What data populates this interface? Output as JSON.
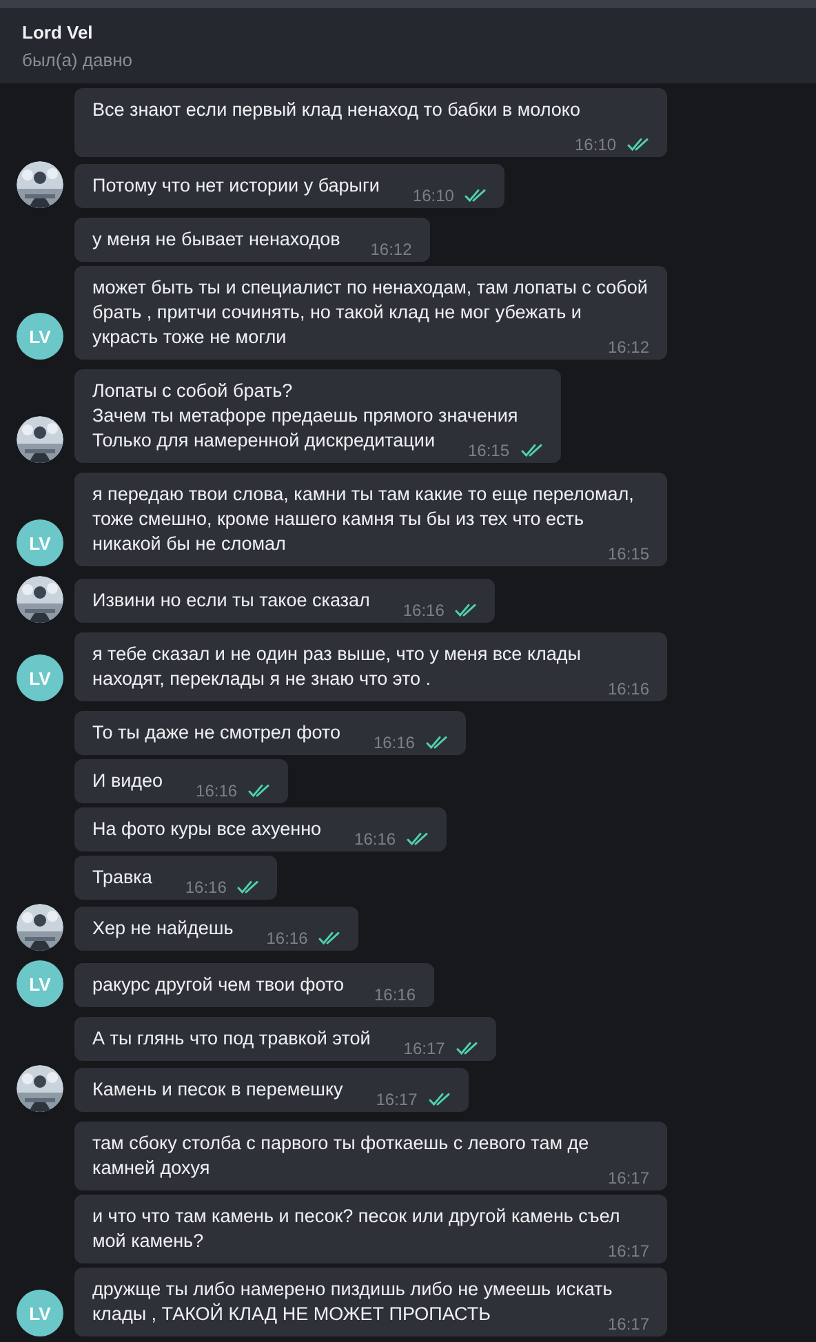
{
  "header": {
    "name": "Lord Vel",
    "status": "был(а) давно"
  },
  "messages": [
    {
      "kind": "outgoing",
      "text": "Все знают если первый клад ненаход то бабки в молоко",
      "time": "16:10",
      "read": true
    },
    {
      "kind": "outgoing",
      "text": "Потому что нет истории у барыги",
      "time": "16:10",
      "read": true
    },
    {
      "kind": "incoming",
      "text": "у меня не бывает ненаходов",
      "time": "16:12"
    },
    {
      "kind": "incoming",
      "text": "может быть ты и специалист по ненаходам, там лопаты с собой брать , притчи сочинять, но такой клад не мог убежать и украсть тоже не могли",
      "time": "16:12",
      "avatar": {
        "kind": "initials",
        "text": "LV"
      }
    },
    {
      "kind": "outgoing",
      "text": "Лопаты с собой брать?\nЗачем ты метафоре предаешь прямого значения\nТолько для намеренной дискредитации",
      "time": "16:15",
      "read": true
    },
    {
      "kind": "incoming",
      "text": "я передаю твои слова, камни ты там какие то еще переломал, тоже смешно, кроме нашего камня ты бы из тех что есть никакой бы не сломал",
      "time": "16:15",
      "avatar": {
        "kind": "initials",
        "text": "LV"
      }
    },
    {
      "kind": "outgoing",
      "text": "Извини но если ты такое сказал",
      "time": "16:16",
      "read": true
    },
    {
      "kind": "incoming",
      "text": "я тебе сказал и не один раз выше, что у меня все клады находят, переклады я не знаю что это .",
      "time": "16:16",
      "avatar": {
        "kind": "initials",
        "text": "LV"
      }
    },
    {
      "kind": "outgoing",
      "text": "То ты даже не смотрел фото",
      "time": "16:16",
      "read": true
    },
    {
      "kind": "outgoing",
      "text": "И видео",
      "time": "16:16",
      "read": true
    },
    {
      "kind": "outgoing",
      "text": "На фото куры все ахуенно",
      "time": "16:16",
      "read": true
    },
    {
      "kind": "outgoing",
      "text": "Травка",
      "time": "16:16",
      "read": true
    },
    {
      "kind": "outgoing",
      "text": "Хер не найдешь",
      "time": "16:16",
      "read": true
    },
    {
      "kind": "incoming",
      "text": "ракурс другой чем твои фото",
      "time": "16:16",
      "avatar": {
        "kind": "initials",
        "text": "LV"
      }
    },
    {
      "kind": "outgoing",
      "text": "А ты глянь что под травкой этой",
      "time": "16:17",
      "read": true
    },
    {
      "kind": "outgoing",
      "text": "Камень и песок в перемешку",
      "time": "16:17",
      "read": true
    },
    {
      "kind": "incoming",
      "text": "там сбоку столба с парвого ты фоткаешь с левого там де камней дохуя",
      "time": "16:17"
    },
    {
      "kind": "incoming",
      "text": "и что что там камень и песок? песок или другой камень съел мой камень?",
      "time": "16:17"
    },
    {
      "kind": "incoming",
      "text": "дружще ты либо намерено пиздишь либо не умеешь искать клады , ТАКОЙ КЛАД НЕ МОЖЕТ ПРОПАСТЬ",
      "time": "16:17",
      "avatar": {
        "kind": "initials",
        "text": "LV"
      }
    }
  ]
}
